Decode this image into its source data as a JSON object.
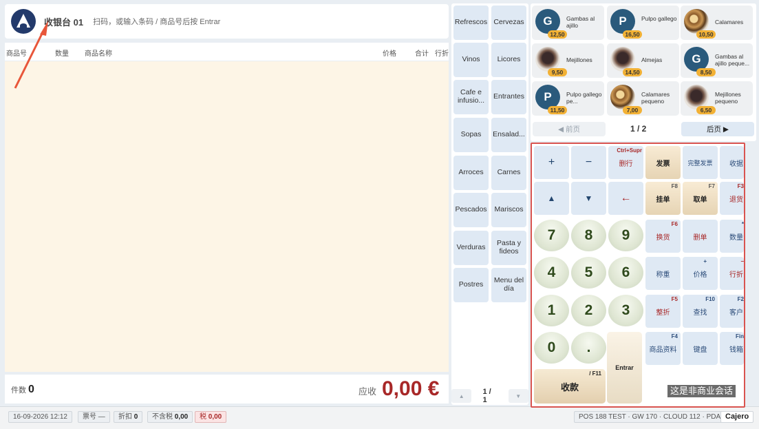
{
  "header": {
    "register": "收银台 01",
    "scan_hint": "扫码，或输入条码 / 商品号后按 Entrar"
  },
  "cart": {
    "columns": [
      "商品号",
      "数量",
      "商品名称",
      "价格",
      "合计",
      "行折"
    ]
  },
  "totals": {
    "pieces_label": "件数",
    "pieces_value": "0",
    "due_label": "应收",
    "due_value": "0,00 €"
  },
  "status_bar": {
    "datetime": "16-09-2026 12:12",
    "ticket": "票号 —",
    "discount_label": "折扣",
    "discount_value": "0",
    "net_label": "不含税",
    "net_value": "0,00",
    "tax_label": "税",
    "tax_value": "0,00",
    "info": "POS 188 TEST · GW 170 · CLOUD 112 · PDA 70",
    "user": "Cajero"
  },
  "categories": [
    "Refrescos",
    "Cervezas",
    "Vinos",
    "Licores",
    "Cafe e infusio...",
    "Entrantes",
    "Sopas",
    "Ensalad...",
    "Arroces",
    "Carnes",
    "Pescados",
    "Mariscos",
    "Verduras",
    "Pasta y fideos",
    "Postres",
    "Menu del día"
  ],
  "category_pager": {
    "prev": "▲",
    "page": "1 / 1",
    "next": "▼"
  },
  "products": [
    {
      "name": "Gambas al ajillo",
      "price": "12,50",
      "image": "initial",
      "initial": "G"
    },
    {
      "name": "Pulpo gallego",
      "price": "16,50",
      "image": "initial",
      "initial": "P"
    },
    {
      "name": "Calamares",
      "price": "10,50",
      "image": "food"
    },
    {
      "name": "Mejillones",
      "price": "9,50",
      "image": "food2"
    },
    {
      "name": "Almejas",
      "price": "14,50",
      "image": "food2"
    },
    {
      "name": "Gambas al ajillo peque...",
      "price": "8,50",
      "image": "initial",
      "initial": "G"
    },
    {
      "name": "Pulpo gallego pe...",
      "price": "11,50",
      "image": "initial",
      "initial": "P"
    },
    {
      "name": "Calamares pequeno",
      "price": "7,00",
      "image": "food"
    },
    {
      "name": "Mejillones pequeno",
      "price": "6,50",
      "image": "food2"
    }
  ],
  "product_pager": {
    "prev": "◀ 前页",
    "page": "1 / 2",
    "next": "后页 ▶"
  },
  "keypad": {
    "plus": "+",
    "minus": "−",
    "delete_line": "删行",
    "delete_line_shortcut": "Ctrl+Supr",
    "invoice": "发票",
    "full_invoice": "完整发票",
    "receipt": "收据",
    "up": "▲",
    "down": "▼",
    "backspace": "←",
    "hold": "挂单",
    "hold_shortcut": "F8",
    "recall": "取单",
    "recall_shortcut": "F7",
    "return": "退货",
    "return_shortcut": "F3",
    "exchange": "换货",
    "exchange_shortcut": "F6",
    "delete_order": "删单",
    "quantity": "数量",
    "quantity_shortcut": "*",
    "weigh": "称重",
    "price": "价格",
    "price_shortcut": "+",
    "line_discount": "行折",
    "line_discount_shortcut": "−",
    "order_discount": "整折",
    "order_discount_shortcut": "F5",
    "search": "查找",
    "search_shortcut": "F10",
    "customer": "客户",
    "customer_shortcut": "F2",
    "product_info": "商品资料",
    "product_info_shortcut": "F4",
    "keyboard": "键盘",
    "cash_drawer": "钱箱",
    "cash_drawer_shortcut": "Fin",
    "digits": [
      "7",
      "8",
      "9",
      "4",
      "5",
      "6",
      "1",
      "2",
      "3",
      "0",
      "."
    ],
    "enter": "Entrar",
    "collect": "收款",
    "collect_shortcut": "/ F11"
  },
  "watermark": "这是非商业会话",
  "colors": {
    "accent_red": "#a82828",
    "highlight_border": "#d9534f",
    "cart_bg": "#fdf5e6",
    "price_tag": "#f2b135",
    "brand_blue": "#233a6b"
  }
}
